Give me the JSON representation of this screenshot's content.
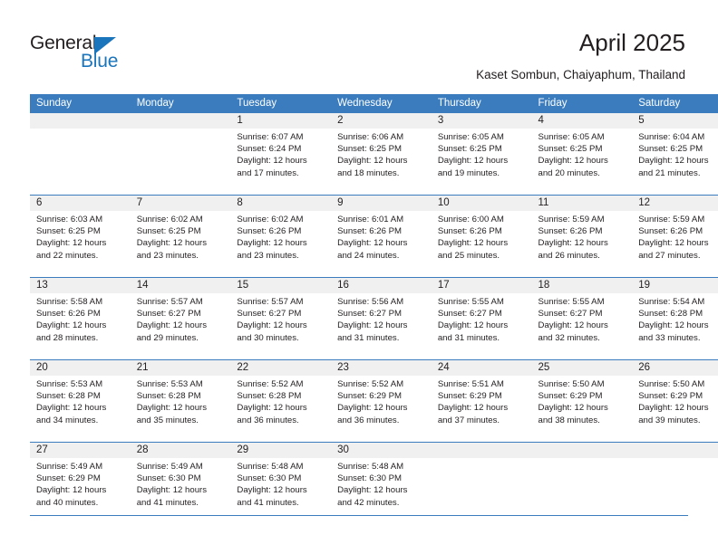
{
  "brand": {
    "name_dark": "General",
    "name_blue": "Blue",
    "accent_color": "#1a75bc"
  },
  "header": {
    "title": "April 2025",
    "subtitle": "Kaset Sombun, Chaiyaphum, Thailand"
  },
  "theme": {
    "header_blue": "#3a7cbe",
    "daynum_band": "#f0f0f0",
    "text": "#231f20"
  },
  "weekdays": [
    "Sunday",
    "Monday",
    "Tuesday",
    "Wednesday",
    "Thursday",
    "Friday",
    "Saturday"
  ],
  "weeks": [
    [
      {
        "day": "",
        "lines": []
      },
      {
        "day": "",
        "lines": []
      },
      {
        "day": "1",
        "lines": [
          "Sunrise: 6:07 AM",
          "Sunset: 6:24 PM",
          "Daylight: 12 hours",
          "and 17 minutes."
        ]
      },
      {
        "day": "2",
        "lines": [
          "Sunrise: 6:06 AM",
          "Sunset: 6:25 PM",
          "Daylight: 12 hours",
          "and 18 minutes."
        ]
      },
      {
        "day": "3",
        "lines": [
          "Sunrise: 6:05 AM",
          "Sunset: 6:25 PM",
          "Daylight: 12 hours",
          "and 19 minutes."
        ]
      },
      {
        "day": "4",
        "lines": [
          "Sunrise: 6:05 AM",
          "Sunset: 6:25 PM",
          "Daylight: 12 hours",
          "and 20 minutes."
        ]
      },
      {
        "day": "5",
        "lines": [
          "Sunrise: 6:04 AM",
          "Sunset: 6:25 PM",
          "Daylight: 12 hours",
          "and 21 minutes."
        ]
      }
    ],
    [
      {
        "day": "6",
        "lines": [
          "Sunrise: 6:03 AM",
          "Sunset: 6:25 PM",
          "Daylight: 12 hours",
          "and 22 minutes."
        ]
      },
      {
        "day": "7",
        "lines": [
          "Sunrise: 6:02 AM",
          "Sunset: 6:25 PM",
          "Daylight: 12 hours",
          "and 23 minutes."
        ]
      },
      {
        "day": "8",
        "lines": [
          "Sunrise: 6:02 AM",
          "Sunset: 6:26 PM",
          "Daylight: 12 hours",
          "and 23 minutes."
        ]
      },
      {
        "day": "9",
        "lines": [
          "Sunrise: 6:01 AM",
          "Sunset: 6:26 PM",
          "Daylight: 12 hours",
          "and 24 minutes."
        ]
      },
      {
        "day": "10",
        "lines": [
          "Sunrise: 6:00 AM",
          "Sunset: 6:26 PM",
          "Daylight: 12 hours",
          "and 25 minutes."
        ]
      },
      {
        "day": "11",
        "lines": [
          "Sunrise: 5:59 AM",
          "Sunset: 6:26 PM",
          "Daylight: 12 hours",
          "and 26 minutes."
        ]
      },
      {
        "day": "12",
        "lines": [
          "Sunrise: 5:59 AM",
          "Sunset: 6:26 PM",
          "Daylight: 12 hours",
          "and 27 minutes."
        ]
      }
    ],
    [
      {
        "day": "13",
        "lines": [
          "Sunrise: 5:58 AM",
          "Sunset: 6:26 PM",
          "Daylight: 12 hours",
          "and 28 minutes."
        ]
      },
      {
        "day": "14",
        "lines": [
          "Sunrise: 5:57 AM",
          "Sunset: 6:27 PM",
          "Daylight: 12 hours",
          "and 29 minutes."
        ]
      },
      {
        "day": "15",
        "lines": [
          "Sunrise: 5:57 AM",
          "Sunset: 6:27 PM",
          "Daylight: 12 hours",
          "and 30 minutes."
        ]
      },
      {
        "day": "16",
        "lines": [
          "Sunrise: 5:56 AM",
          "Sunset: 6:27 PM",
          "Daylight: 12 hours",
          "and 31 minutes."
        ]
      },
      {
        "day": "17",
        "lines": [
          "Sunrise: 5:55 AM",
          "Sunset: 6:27 PM",
          "Daylight: 12 hours",
          "and 31 minutes."
        ]
      },
      {
        "day": "18",
        "lines": [
          "Sunrise: 5:55 AM",
          "Sunset: 6:27 PM",
          "Daylight: 12 hours",
          "and 32 minutes."
        ]
      },
      {
        "day": "19",
        "lines": [
          "Sunrise: 5:54 AM",
          "Sunset: 6:28 PM",
          "Daylight: 12 hours",
          "and 33 minutes."
        ]
      }
    ],
    [
      {
        "day": "20",
        "lines": [
          "Sunrise: 5:53 AM",
          "Sunset: 6:28 PM",
          "Daylight: 12 hours",
          "and 34 minutes."
        ]
      },
      {
        "day": "21",
        "lines": [
          "Sunrise: 5:53 AM",
          "Sunset: 6:28 PM",
          "Daylight: 12 hours",
          "and 35 minutes."
        ]
      },
      {
        "day": "22",
        "lines": [
          "Sunrise: 5:52 AM",
          "Sunset: 6:28 PM",
          "Daylight: 12 hours",
          "and 36 minutes."
        ]
      },
      {
        "day": "23",
        "lines": [
          "Sunrise: 5:52 AM",
          "Sunset: 6:29 PM",
          "Daylight: 12 hours",
          "and 36 minutes."
        ]
      },
      {
        "day": "24",
        "lines": [
          "Sunrise: 5:51 AM",
          "Sunset: 6:29 PM",
          "Daylight: 12 hours",
          "and 37 minutes."
        ]
      },
      {
        "day": "25",
        "lines": [
          "Sunrise: 5:50 AM",
          "Sunset: 6:29 PM",
          "Daylight: 12 hours",
          "and 38 minutes."
        ]
      },
      {
        "day": "26",
        "lines": [
          "Sunrise: 5:50 AM",
          "Sunset: 6:29 PM",
          "Daylight: 12 hours",
          "and 39 minutes."
        ]
      }
    ],
    [
      {
        "day": "27",
        "lines": [
          "Sunrise: 5:49 AM",
          "Sunset: 6:29 PM",
          "Daylight: 12 hours",
          "and 40 minutes."
        ]
      },
      {
        "day": "28",
        "lines": [
          "Sunrise: 5:49 AM",
          "Sunset: 6:30 PM",
          "Daylight: 12 hours",
          "and 41 minutes."
        ]
      },
      {
        "day": "29",
        "lines": [
          "Sunrise: 5:48 AM",
          "Sunset: 6:30 PM",
          "Daylight: 12 hours",
          "and 41 minutes."
        ]
      },
      {
        "day": "30",
        "lines": [
          "Sunrise: 5:48 AM",
          "Sunset: 6:30 PM",
          "Daylight: 12 hours",
          "and 42 minutes."
        ]
      },
      {
        "day": "",
        "lines": []
      },
      {
        "day": "",
        "lines": []
      },
      {
        "day": "",
        "lines": []
      }
    ]
  ]
}
